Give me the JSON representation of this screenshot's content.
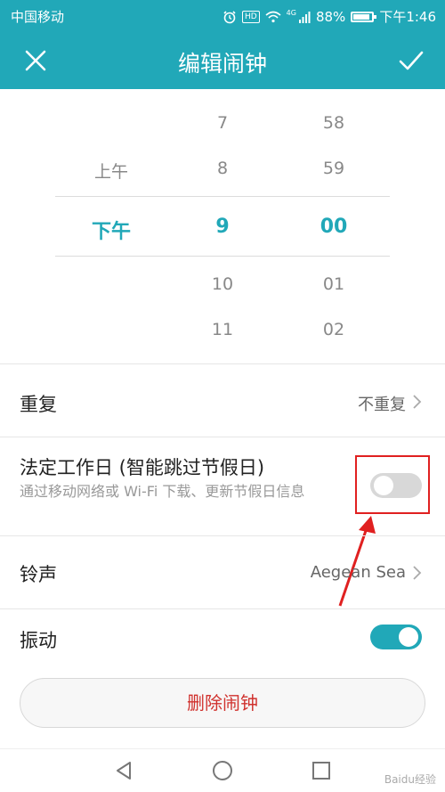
{
  "status_bar": {
    "carrier": "中国移动",
    "network": "4G",
    "hd_badge": "HD",
    "battery": "88%",
    "time": "下午1:46"
  },
  "app_bar": {
    "title": "编辑闹钟"
  },
  "picker": {
    "ampm": {
      "options": [
        "上午",
        "下午"
      ],
      "selected": "下午"
    },
    "hours": {
      "before": [
        "7",
        "8"
      ],
      "selected": "9",
      "after": [
        "10",
        "11"
      ]
    },
    "minutes": {
      "before": [
        "58",
        "59"
      ],
      "selected": "00",
      "after": [
        "01",
        "02"
      ]
    }
  },
  "settings": {
    "repeat": {
      "label": "重复",
      "value": "不重复"
    },
    "workday": {
      "label": "法定工作日 (智能跳过节假日)",
      "description": "通过移动网络或 Wi-Fi 下载、更新节假日信息",
      "enabled": false
    },
    "ringtone": {
      "label": "铃声",
      "value": "Aegean Sea"
    },
    "vibrate": {
      "label": "振动",
      "enabled": true
    }
  },
  "delete_button": "删除闹钟",
  "watermark": "Baidu经验",
  "colors": {
    "accent": "#21a8b8",
    "delete_text": "#d0312d",
    "annotation": "#e02020"
  }
}
